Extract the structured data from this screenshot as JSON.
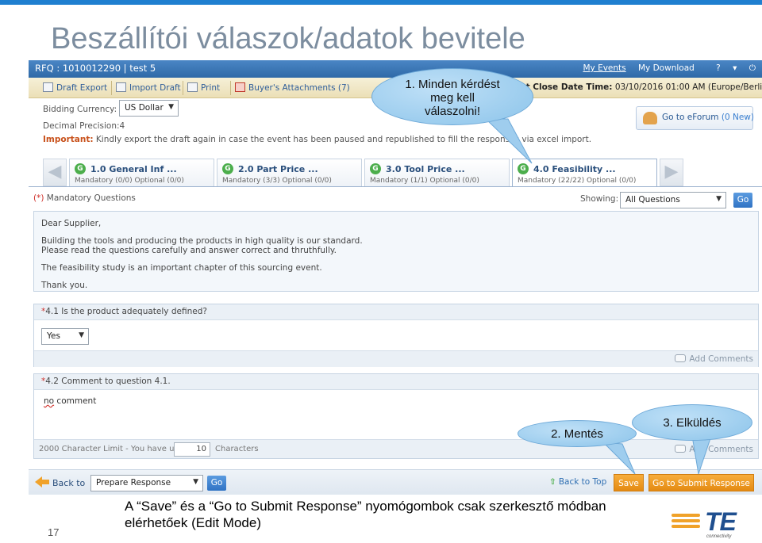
{
  "slide": {
    "title": "Beszállítói válaszok/adatok bevitele",
    "number": "17",
    "caption_line1": "A “Save” és a “Go to Submit Response” nyomógombok csak szerkesztő módban",
    "caption_line2": "elérhetőek (Edit Mode)"
  },
  "callouts": {
    "c1_line1": "1. Minden kérdést",
    "c1_line2": "meg kell",
    "c1_line3": "válaszolni!",
    "c2": "2. Mentés",
    "c3": "3. Elküldés"
  },
  "header": {
    "rfq_title": "RFQ : 1010012290 | test 5",
    "my_events": "My Events",
    "my_download": "My Download",
    "help": "?",
    "help_arrow": "▾"
  },
  "toolbar": {
    "draft_export": "Draft Export",
    "import_draft": "Import Draft",
    "print": "Print",
    "buyer_attachments": "Buyer's Attachments (7)",
    "event_close_label": "Event Close Date Time:",
    "event_close_value": "03/10/2016 01:00 AM  (Europe/Berlin)"
  },
  "settings": {
    "bidding_currency_label": "Bidding Currency:",
    "bidding_currency_value": "US Dollar",
    "decimal_precision": "Decimal Precision:4",
    "important_label": "Important:",
    "important_text": " Kindly export the draft again in case the event has been paused and republished to fill the responses via excel import."
  },
  "eforum": {
    "label": "Go to eForum",
    "new": "(0 New)"
  },
  "tabs": [
    {
      "badge": "G",
      "name": "1.0 General Inf ...",
      "sub": "Mandatory (0/0) Optional (0/0)"
    },
    {
      "badge": "G",
      "name": "2.0 Part Price  ...",
      "sub": "Mandatory (3/3) Optional (0/0)"
    },
    {
      "badge": "G",
      "name": "3.0 Tool Price  ...",
      "sub": "Mandatory (1/1) Optional (0/0)"
    },
    {
      "badge": "G",
      "name": "4.0 Feasibility ...",
      "sub": "Mandatory (22/22) Optional (0/0)"
    }
  ],
  "filter": {
    "mandatory_star": "(*)",
    "mandatory_text": " Mandatory Questions",
    "showing_label": "Showing:",
    "showing_value": "All Questions",
    "go": "Go"
  },
  "intro": {
    "l1": "Dear Supplier,",
    "l2": "Building the tools and producing the products in high quality is our standard.",
    "l3": "Please read the questions carefully and answer correct and thruthfully.",
    "l4": "The feasibility study is an important chapter of this sourcing event.",
    "l5": "Thank you."
  },
  "q41": {
    "star": "*",
    "text": "4.1 Is the product adequately defined?",
    "answer": "Yes",
    "add_comments": "Add Comments"
  },
  "q42": {
    "star": "*",
    "text": "4.2 Comment to question 4.1.",
    "answer_word1": "no",
    "answer_word2": " comment",
    "char_limit_text": "2000 Character Limit - You have used",
    "char_used": "10",
    "characters": "Characters",
    "add_comments": "Add Comments"
  },
  "footer": {
    "back_to": "Back to",
    "prepare_response": "Prepare Response",
    "go": "Go",
    "back_to_top": "Back to Top",
    "save": "Save",
    "submit": "Go to Submit Response"
  },
  "logo": {
    "text": "TE",
    "tagline": "connectivity"
  },
  "colors": {
    "header_blue": "#2f69a7",
    "accent_orange": "#e48a12",
    "callout_blue": "#8cc4ea",
    "title_gray": "#7c8d9f"
  }
}
